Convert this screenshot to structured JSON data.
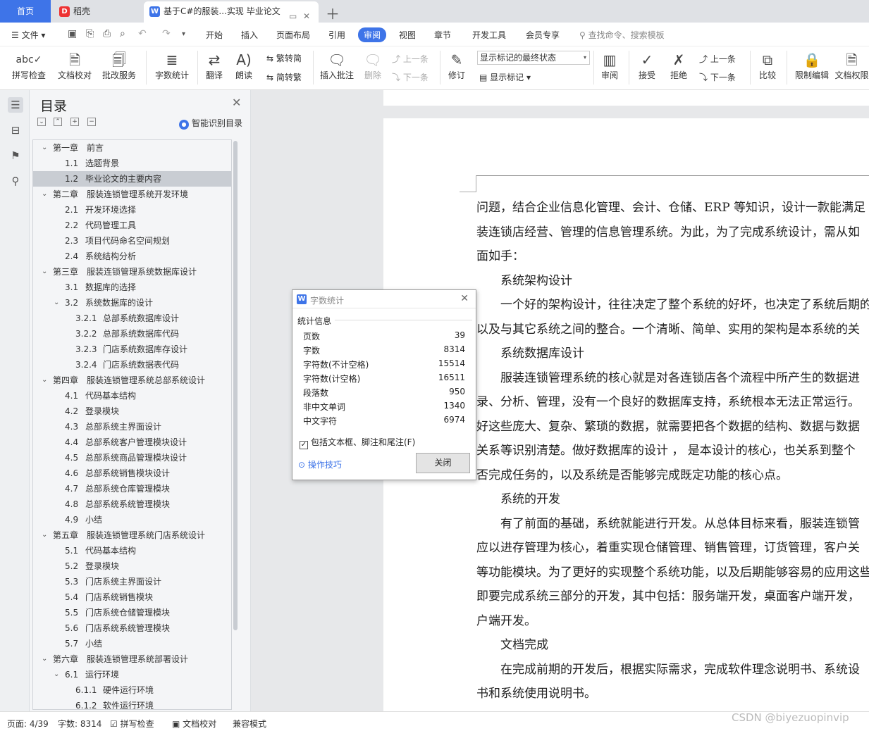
{
  "tabs": {
    "home": "首页",
    "daoke": "稻壳",
    "doc": "基于C#的服装...实现 毕业论文"
  },
  "menu": {
    "file": "文件",
    "items": [
      "开始",
      "插入",
      "页面布局",
      "引用",
      "审阅",
      "视图",
      "章节",
      "开发工具",
      "会员专享"
    ],
    "active": "审阅",
    "search": "查找命令、搜索模板"
  },
  "ribbon": {
    "spell": "拼写检查",
    "doccheck": "文档校对",
    "batch": "批改服务",
    "wordcount": "字数统计",
    "translate": "翻译",
    "read": "朗读",
    "trad": "繁转简",
    "simp": "简转繁",
    "comment": "插入批注",
    "delete": "删除",
    "prev": "上一条",
    "next": "下一条",
    "revise": "修订",
    "markup_select": "显示标记的最终状态",
    "show_markup": "显示标记",
    "review": "审阅",
    "accept": "接受",
    "reject": "拒绝",
    "prev2": "上一条",
    "next2": "下一条",
    "compare": "比较",
    "restrict": "限制编辑",
    "perm": "文档权限"
  },
  "toc": {
    "title": "目录",
    "smart": "智能识别目录",
    "items": [
      {
        "num": "第一章",
        "text": "前言",
        "level": 0,
        "expand": true
      },
      {
        "num": "1.1",
        "text": "选题背景",
        "level": 1
      },
      {
        "num": "1.2",
        "text": "毕业论文的主要内容",
        "level": 1,
        "selected": true
      },
      {
        "num": "第二章",
        "text": "服装连锁管理系统开发环境",
        "level": 0,
        "expand": true
      },
      {
        "num": "2.1",
        "text": "开发环境选择",
        "level": 1
      },
      {
        "num": "2.2",
        "text": "代码管理工具",
        "level": 1
      },
      {
        "num": "2.3",
        "text": "项目代码命名空间规划",
        "level": 1
      },
      {
        "num": "2.4",
        "text": "系统结构分析",
        "level": 1
      },
      {
        "num": "第三章",
        "text": "服装连锁管理系统数据库设计",
        "level": 0,
        "expand": true
      },
      {
        "num": "3.1",
        "text": "数据库的选择",
        "level": 1
      },
      {
        "num": "3.2",
        "text": "系统数据库的设计",
        "level": 1,
        "expand": true
      },
      {
        "num": "3.2.1",
        "text": "总部系统数据库设计",
        "level": 2
      },
      {
        "num": "3.2.2",
        "text": "总部系统数据库代码",
        "level": 2
      },
      {
        "num": "3.2.3",
        "text": "门店系统数据库存设计",
        "level": 2
      },
      {
        "num": "3.2.4",
        "text": "门店系统数据表代码",
        "level": 2
      },
      {
        "num": "第四章",
        "text": "服装连锁管理系统总部系统设计",
        "level": 0,
        "expand": true
      },
      {
        "num": "4.1",
        "text": "代码基本结构",
        "level": 1
      },
      {
        "num": "4.2",
        "text": "登录模块",
        "level": 1
      },
      {
        "num": "4.3",
        "text": "总部系统主界面设计",
        "level": 1
      },
      {
        "num": "4.4",
        "text": "总部系统客户管理模块设计",
        "level": 1
      },
      {
        "num": "4.5",
        "text": "总部系统商品管理模块设计",
        "level": 1
      },
      {
        "num": "4.6",
        "text": "总部系统销售模块设计",
        "level": 1
      },
      {
        "num": "4.7",
        "text": "总部系统仓库管理模块",
        "level": 1
      },
      {
        "num": "4.8",
        "text": "总部系统系统管理模块",
        "level": 1
      },
      {
        "num": "4.9",
        "text": "小结",
        "level": 1
      },
      {
        "num": "第五章",
        "text": "服装连锁管理系统门店系统设计",
        "level": 0,
        "expand": true
      },
      {
        "num": "5.1",
        "text": "代码基本结构",
        "level": 1
      },
      {
        "num": "5.2",
        "text": "登录模块",
        "level": 1
      },
      {
        "num": "5.3",
        "text": "门店系统主界面设计",
        "level": 1
      },
      {
        "num": "5.4",
        "text": "门店系统销售模块",
        "level": 1
      },
      {
        "num": "5.5",
        "text": "门店系统仓储管理模块",
        "level": 1
      },
      {
        "num": "5.6",
        "text": "门店系统系统管理模块",
        "level": 1
      },
      {
        "num": "5.7",
        "text": "小结",
        "level": 1
      },
      {
        "num": "第六章",
        "text": "服装连锁管理系统部署设计",
        "level": 0,
        "expand": true
      },
      {
        "num": "6.1",
        "text": "运行环境",
        "level": 1,
        "expand": true
      },
      {
        "num": "6.1.1",
        "text": "硬件运行环境",
        "level": 2
      },
      {
        "num": "6.1.2",
        "text": "软件运行环境",
        "level": 2
      }
    ]
  },
  "doc": {
    "paragraphs": [
      "问题，结合企业信息化管理、会计、仓储、ERP 等知识，设计一款能满足",
      "装连锁店经营、管理的信息管理系统。为此，为了完成系统设计，需从如",
      "面如手：",
      "　　系统架构设计",
      "　　一个好的架构设计，往往决定了整个系统的好坏，也决定了系统后期的",
      "以及与其它系统之间的整合。一个清晰、简单、实用的架构是本系统的关",
      "　　系统数据库设计",
      "　　服装连锁管理系统的核心就是对各连锁店各个流程中所产生的数据进",
      "录、分析、管理，没有一个良好的数据库支持，系统根本无法正常运行。",
      "好这些庞大、复杂、繁琐的数据，就需要把各个数据的结构、数据与数据",
      "关系等识别清楚。做好数据库的设计 ， 是本设计的核心，也关系到整个",
      "否完成任务的，以及系统是否能够完成既定功能的核心点。",
      "　　系统的开发",
      "　　有了前面的基础，系统就能进行开发。从总体目标来看，服装连锁管",
      "应以进存管理为核心，着重实现仓储管理、销售管理，订货管理，客户关",
      "等功能模块。为了更好的实现整个系统功能，以及后期能够容易的应用这些",
      "即要完成系统三部分的开发，其中包括：服务端开发，桌面客户端开发，",
      "户端开发。",
      "　　文档完成",
      "　　在完成前期的开发后，根据实际需求，完成软件理念说明书、系统设",
      "书和系统使用说明书。"
    ]
  },
  "dialog": {
    "title": "字数统计",
    "section": "统计信息",
    "rows": [
      {
        "label": "页数",
        "value": "39"
      },
      {
        "label": "字数",
        "value": "8314"
      },
      {
        "label": "字符数(不计空格)",
        "value": "15514"
      },
      {
        "label": "字符数(计空格)",
        "value": "16511"
      },
      {
        "label": "段落数",
        "value": "950"
      },
      {
        "label": "非中文单词",
        "value": "1340"
      },
      {
        "label": "中文字符",
        "value": "6974"
      }
    ],
    "checkbox": "包括文本框、脚注和尾注(F)",
    "tips": "操作技巧",
    "close": "关闭"
  },
  "status": {
    "page": "页面: 4/39",
    "words": "字数: 8314",
    "spell": "拼写检查",
    "doccheck": "文档校对",
    "compat": "兼容模式"
  },
  "watermark": "CSDN @biyezuopinvip",
  "colors": {
    "accent": "#3e74e8"
  }
}
